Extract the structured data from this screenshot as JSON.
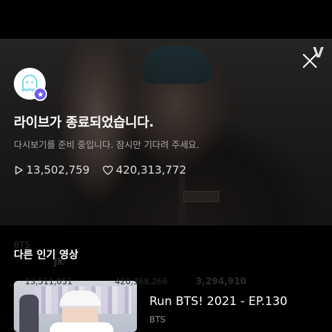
{
  "watermark": "V",
  "live_ended": {
    "title": "라이브가 종료되었습니다.",
    "subtitle": "다시보기를 준비 중입니다. 잠시만 기다려 주세요.",
    "views": "13,502,759",
    "likes": "420,313,772"
  },
  "ghost_behind": {
    "channel": "BTS",
    "title": "JK",
    "views": "13,511,051",
    "likes": "420,368,266",
    "comments": "3,294,910"
  },
  "popular": {
    "section_title": "다른 인기 영상",
    "items": [
      {
        "title": "Run BTS! 2021 - EP.130",
        "channel": "BTS"
      }
    ]
  },
  "colors": {
    "badge": "#6e5cf0",
    "avatar_face": "#72d6e0"
  }
}
